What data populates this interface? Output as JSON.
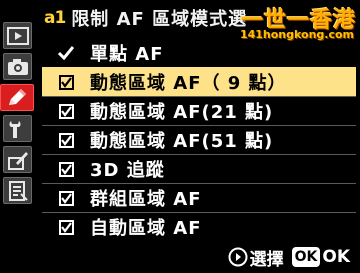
{
  "header": {
    "code": "a1",
    "title": "限制 AF 區域模式選",
    "watermark_zh": "一世一香港",
    "watermark_url": "141hongkong.com"
  },
  "sidebar": {
    "items": [
      {
        "icon": "playback-icon",
        "active": false
      },
      {
        "icon": "camera-icon",
        "active": false
      },
      {
        "icon": "pencil-icon",
        "active": true
      },
      {
        "icon": "wrench-icon",
        "active": false
      },
      {
        "icon": "retouch-icon",
        "active": false
      },
      {
        "icon": "my-menu-icon",
        "active": false
      }
    ]
  },
  "options": [
    {
      "label": "單點 AF",
      "type": "check",
      "checked": true,
      "highlight": false
    },
    {
      "label": "動態區域 AF（ 9 點）",
      "type": "box",
      "checked": true,
      "highlight": true
    },
    {
      "label": "動態區域 AF(21 點)",
      "type": "box",
      "checked": true,
      "highlight": false
    },
    {
      "label": "動態區域 AF(51 點)",
      "type": "box",
      "checked": true,
      "highlight": false
    },
    {
      "label": "3D 追蹤",
      "type": "box",
      "checked": true,
      "highlight": false
    },
    {
      "label": "群組區域 AF",
      "type": "box",
      "checked": true,
      "highlight": false
    },
    {
      "label": "自動區域 AF",
      "type": "box",
      "checked": true,
      "highlight": false
    }
  ],
  "footer": {
    "select_label": "選擇",
    "ok_label": "OK"
  },
  "colors": {
    "highlight": "#fde28a",
    "active_tab": "#d81e1e",
    "code": "#ffd23a",
    "watermark": "#ffb000"
  }
}
